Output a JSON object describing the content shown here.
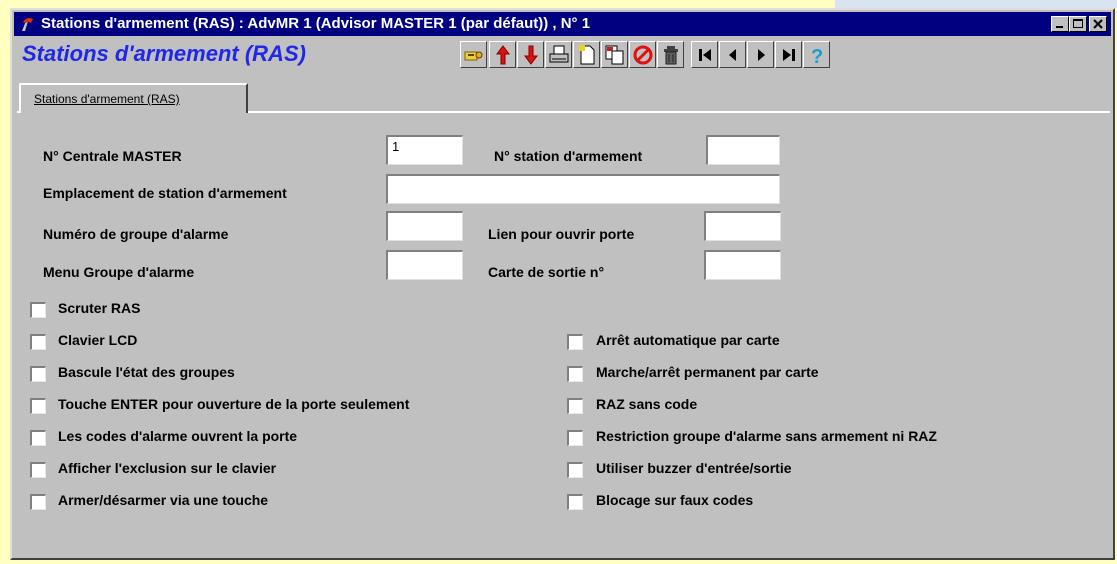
{
  "window": {
    "title": "Stations d'armement (RAS) : AdvMR 1 (Advisor MASTER 1 (par défaut)) , N° 1"
  },
  "header": {
    "form_title": "Stations d'armement (RAS)",
    "toolbar_icons": [
      "key-icon",
      "arrow-up-icon",
      "arrow-down-icon",
      "print-icon",
      "new-icon",
      "copy-icon",
      "cancel-icon",
      "delete-icon",
      "first-icon",
      "previous-icon",
      "next-icon",
      "last-icon",
      "help-icon"
    ]
  },
  "tabs": [
    {
      "label": "Stations d'armement (RAS)"
    }
  ],
  "form": {
    "master_label": "N° Centrale MASTER",
    "master_value": "1",
    "station_label": "N° station d'armement",
    "station_value": "",
    "location_label": "Emplacement de station d'armement",
    "location_value": "",
    "group_label": "Numéro de groupe d'alarme",
    "group_value": "",
    "door_label": "Lien pour ouvrir porte",
    "door_value": "",
    "menu_label": "Menu Groupe d'alarme",
    "menu_value": "",
    "card_label": "Carte de sortie n°",
    "card_value": ""
  },
  "checkboxes_left": [
    {
      "label": "Scruter RAS",
      "checked": false
    },
    {
      "label": "Clavier LCD",
      "checked": false
    },
    {
      "label": "Bascule l'état des groupes",
      "checked": false
    },
    {
      "label": "Touche ENTER pour ouverture de la porte seulement",
      "checked": false
    },
    {
      "label": "Les codes d'alarme ouvrent la porte",
      "checked": false
    },
    {
      "label": "Afficher l'exclusion sur le clavier",
      "checked": false
    },
    {
      "label": "Armer/désarmer via une touche",
      "checked": false
    }
  ],
  "checkboxes_right": [
    {
      "label": "Arrêt automatique par carte",
      "checked": false
    },
    {
      "label": "Marche/arrêt permanent par carte",
      "checked": false
    },
    {
      "label": "RAZ sans code",
      "checked": false
    },
    {
      "label": "Restriction groupe d'alarme sans armement ni RAZ",
      "checked": false
    },
    {
      "label": "Utiliser buzzer d'entrée/sortie",
      "checked": false
    },
    {
      "label": "Blocage sur faux codes",
      "checked": false
    }
  ],
  "colors": {
    "titlebar": "#000080",
    "form_title": "#1e28e6",
    "desktop": "#ffffc0",
    "face": "#c0c0c0"
  }
}
